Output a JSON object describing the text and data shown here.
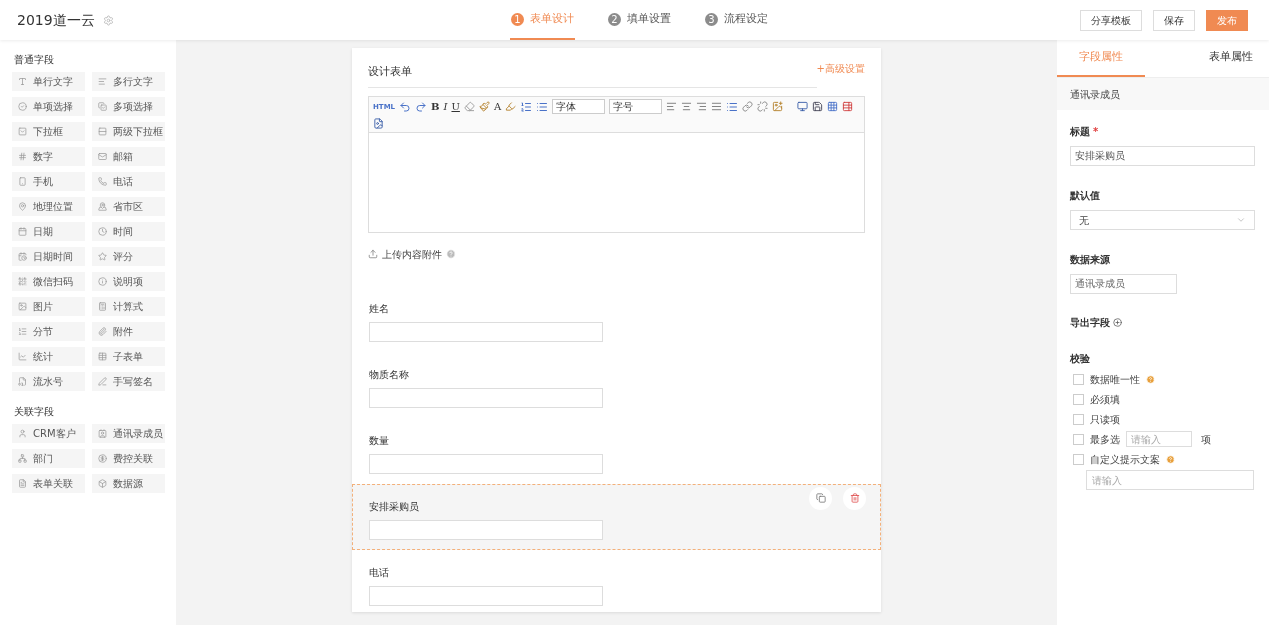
{
  "app": {
    "title": "2019道一云"
  },
  "steps": [
    {
      "number": "1",
      "label": "表单设计",
      "selected": true
    },
    {
      "number": "2",
      "label": "填单设置",
      "selected": false
    },
    {
      "number": "3",
      "label": "流程设定",
      "selected": false
    }
  ],
  "actions": [
    {
      "label": "分享模板",
      "kind": "plain"
    },
    {
      "label": "保存",
      "kind": "plain"
    },
    {
      "label": "发布",
      "kind": "primary"
    }
  ],
  "palette": [
    {
      "title": "普通字段",
      "items": [
        "单行文字",
        "多行文字",
        "单项选择",
        "多项选择",
        "下拉框",
        "两级下拉框",
        "数字",
        "邮箱",
        "手机",
        "电话",
        "地理位置",
        "省市区",
        "日期",
        "时间",
        "日期时间",
        "评分",
        "微信扫码",
        "说明项",
        "图片",
        "计算式",
        "分节",
        "附件",
        "统计",
        "子表单",
        "流水号",
        "手写签名"
      ]
    },
    {
      "title": "关联字段",
      "items": [
        "CRM客户",
        "通讯录成员",
        "部门",
        "费控关联",
        "表单关联",
        "数据源"
      ]
    }
  ],
  "form": {
    "title": "设计表单",
    "advanced_link": "+高级设置",
    "toolbar": {
      "html_label": "HTML",
      "bold": "B",
      "italic": "I",
      "underline": "U",
      "font_color": "A",
      "font_family": "字体",
      "font_size": "字号"
    },
    "upload": "上传内容附件",
    "fields": [
      {
        "label": "姓名",
        "selected": false
      },
      {
        "label": "物质名称",
        "selected": false
      },
      {
        "label": "数量",
        "selected": false
      },
      {
        "label": "安排采购员",
        "selected": true
      },
      {
        "label": "电话",
        "selected": false
      }
    ]
  },
  "panel": {
    "tabs": [
      {
        "label": "字段属性",
        "selected": true
      },
      {
        "label": "表单属性",
        "selected": false
      }
    ],
    "field_type": "通讯录成员",
    "title_label": "标题",
    "required_mark": "*",
    "title_value": "安排采购员",
    "default_label": "默认值",
    "default_value": "无",
    "source_label": "数据来源",
    "source_value": "通讯录成员",
    "export_label": "导出字段",
    "validation_label": "校验",
    "checks": [
      {
        "kind": "help",
        "label": "数据唯一性",
        "checked": false
      },
      {
        "kind": "plain",
        "label": "必须填",
        "checked": false
      },
      {
        "kind": "plain",
        "label": "只读项",
        "checked": false
      },
      {
        "kind": "count",
        "label": "最多选",
        "placeholder": "请输入",
        "unit": "项",
        "checked": false
      },
      {
        "kind": "message",
        "label": "自定义提示文案",
        "placeholder": "请输入",
        "checked": false
      }
    ]
  }
}
